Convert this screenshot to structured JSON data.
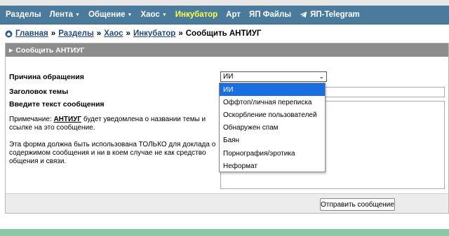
{
  "nav": {
    "items": [
      {
        "label": "Разделы",
        "caret": false,
        "highlight": false
      },
      {
        "label": "Лента",
        "caret": true,
        "highlight": false
      },
      {
        "label": "Общение",
        "caret": true,
        "highlight": false
      },
      {
        "label": "Хаос",
        "caret": true,
        "highlight": false
      },
      {
        "label": "Инкубатор",
        "caret": false,
        "highlight": true
      },
      {
        "label": "Арт",
        "caret": false,
        "highlight": false
      },
      {
        "label": "ЯП Файлы",
        "caret": false,
        "highlight": false
      }
    ],
    "telegram_label": "ЯП-Telegram",
    "caret_glyph": "▼"
  },
  "breadcrumb": {
    "links": [
      "Главная",
      "Разделы",
      "Хаос",
      "Инкубатор"
    ],
    "separator": "»",
    "current": "Сообщить АНТИУГ"
  },
  "panel": {
    "title": "Сообщить АНТИУГ",
    "reason_label": "Причина обращения",
    "subject_label": "Заголовок темы",
    "message_label": "Введите текст сообщения",
    "note_prefix": "Примечание: ",
    "note_target": "АНТИУГ",
    "note_suffix": " будет уведомлена о названии темы и ссылке на это сообщение.",
    "warning": "Эта форма должна быть использована ТОЛЬКО для доклада о содержимом сообщения и ни в коем случае не как средство общения и связи.",
    "select_value": "ИИ",
    "submit_label": "Отправить сообщение"
  },
  "dropdown": {
    "options": [
      "ИИ",
      "Оффтоп/личная переписка",
      "Оскорбление пользователей",
      "Обнаружен спам",
      "Баян",
      "Порнография/эротика",
      "Неформат"
    ],
    "selected_index": 0
  },
  "colors": {
    "nav_bg": "#4a7b9d",
    "nav_highlight": "#ffff44",
    "panel_header_bg": "#8c8c8c",
    "link": "#22497b",
    "selected_option_bg": "#1a6fe0",
    "bottom_stripe": "#8bc8a8"
  }
}
